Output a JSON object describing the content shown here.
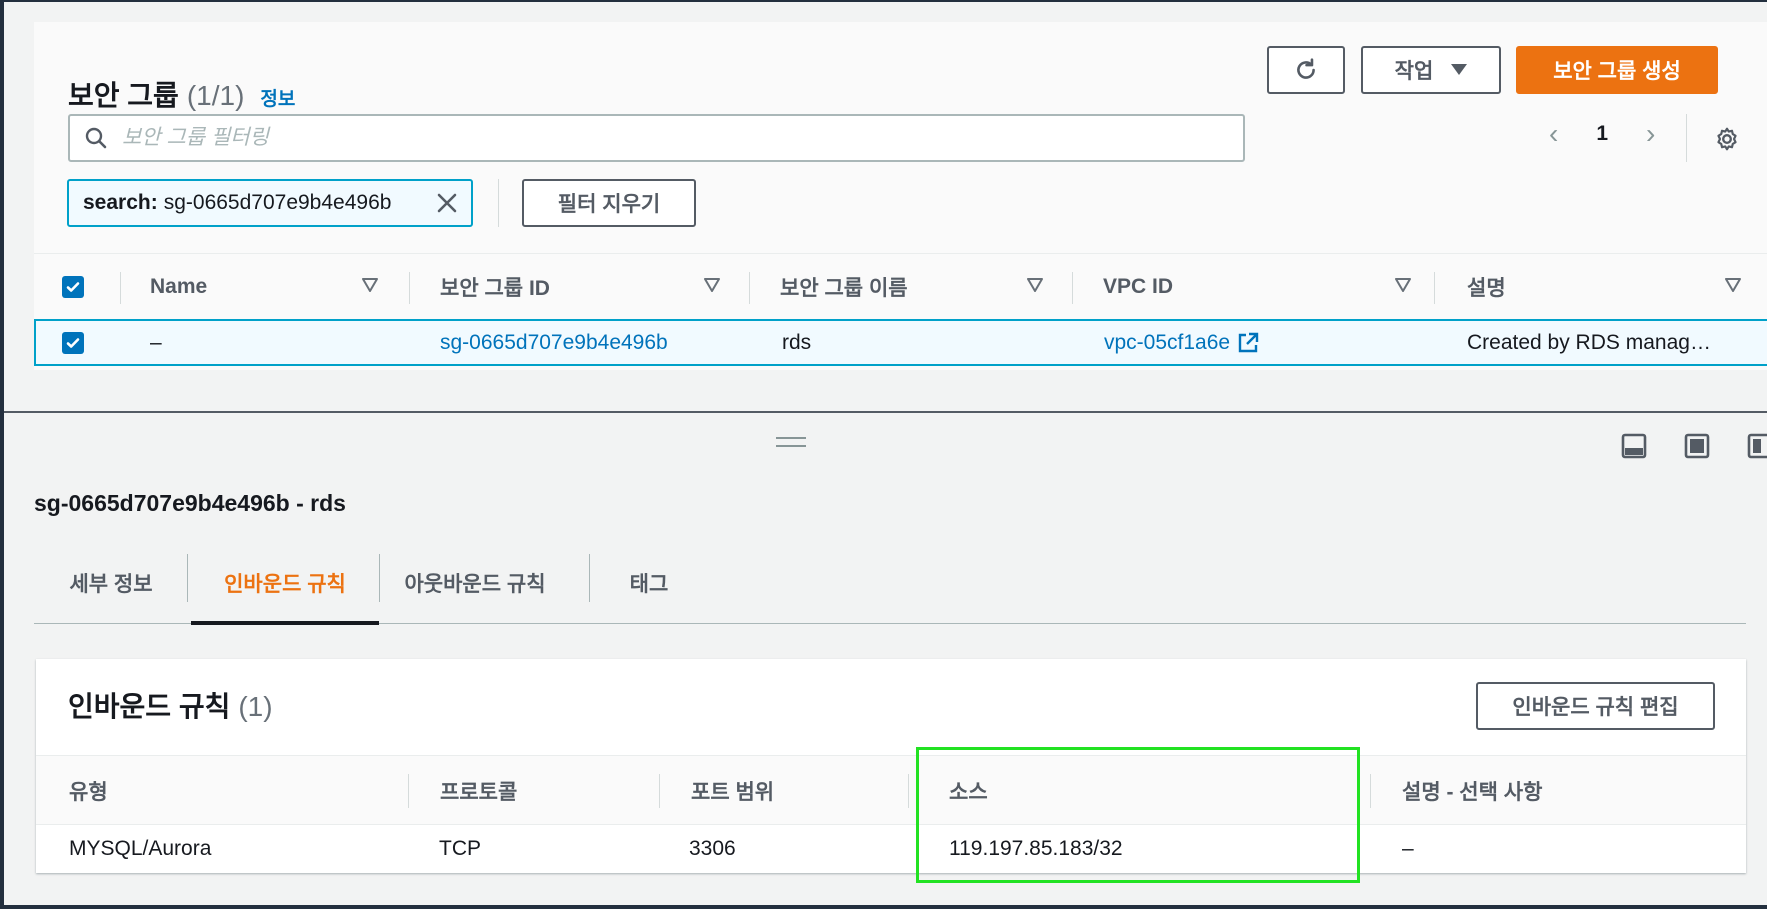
{
  "top": {
    "title": "보안 그룹",
    "count": "(1/1)",
    "info": "정보",
    "actions_label": "작업",
    "create_label": "보안 그룹 생성",
    "search_placeholder": "보안 그룹 필터링",
    "page": "1",
    "token_key": "search:",
    "token_value": "sg-0665d707e9b4e496b",
    "clear_filters": "필터 지우기",
    "columns": [
      "Name",
      "보안 그룹 ID",
      "보안 그룹 이름",
      "VPC ID",
      "설명"
    ],
    "row": {
      "name": "–",
      "group_id": "sg-0665d707e9b4e496b",
      "group_name": "rds",
      "vpc_id": "vpc-05cf1a6e",
      "description": "Created by RDS manag…"
    }
  },
  "detail": {
    "title": "sg-0665d707e9b4e496b - rds",
    "tabs": [
      "세부 정보",
      "인바운드 규칙",
      "아웃바운드 규칙",
      "태그"
    ],
    "active_tab": "인바운드 규칙",
    "rules_title": "인바운드 규칙",
    "rules_count": "(1)",
    "edit_label": "인바운드 규칙 편집",
    "rule_columns": [
      "유형",
      "프로토콜",
      "포트 범위",
      "소스",
      "설명 - 선택 사항"
    ],
    "rule_row": {
      "type": "MYSQL/Aurora",
      "protocol": "TCP",
      "port": "3306",
      "source": "119.197.85.183/32",
      "description": "–"
    }
  },
  "colors": {
    "accent_orange": "#ec7211",
    "link_blue": "#0073bb",
    "selection_border": "#00a1c9",
    "highlight_green": "#22e222"
  }
}
